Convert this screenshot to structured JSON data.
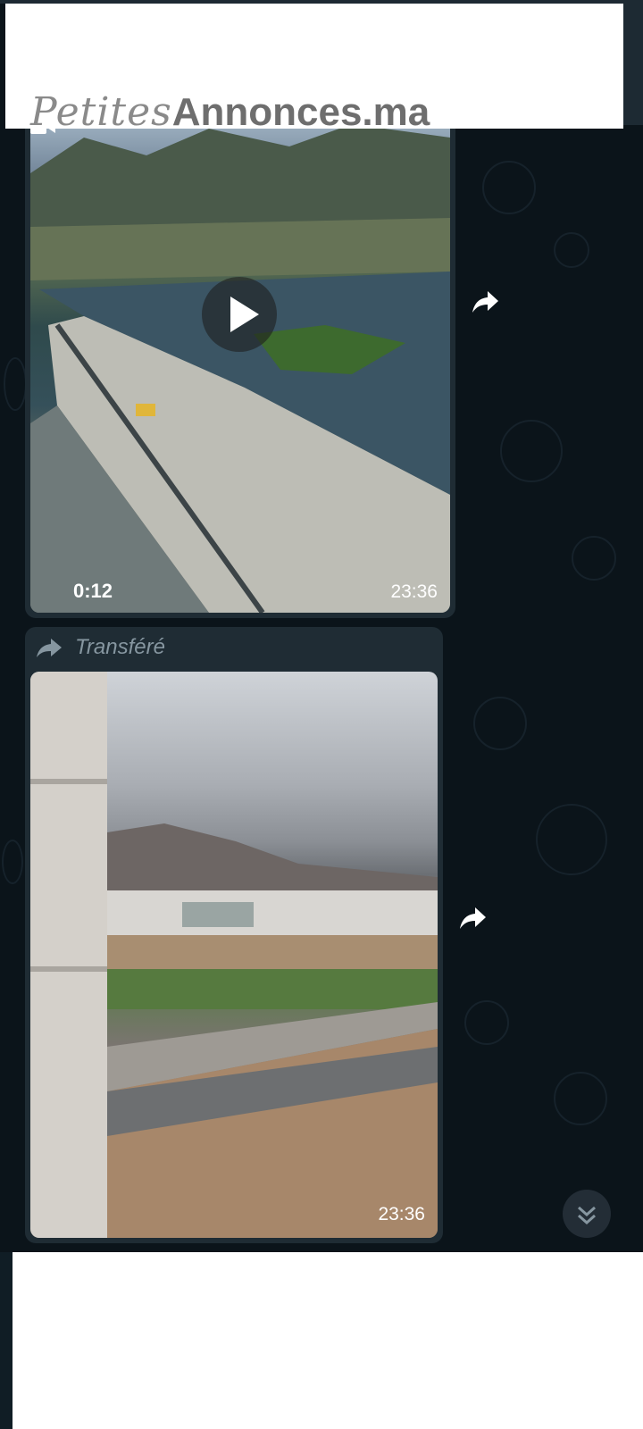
{
  "watermark": {
    "script_part": "Petites",
    "block_part": "Annonces.ma"
  },
  "messages": [
    {
      "type": "video",
      "duration": "0:12",
      "time": "23:36",
      "icons": {
        "play": "play-icon",
        "video": "video-camera-icon",
        "share": "share-forward-icon"
      }
    },
    {
      "type": "video",
      "forwarded_label": "Transféré",
      "time": "23:36",
      "icons": {
        "forwarded": "forwarded-arrow-icon",
        "share": "share-forward-icon"
      }
    }
  ],
  "scroll_button": {
    "icon": "double-chevron-down-icon"
  },
  "colors": {
    "background": "#0b141a",
    "bubble": "#1f2c34",
    "secondary_text": "#8696a0",
    "scroll_button": "#232d36"
  }
}
